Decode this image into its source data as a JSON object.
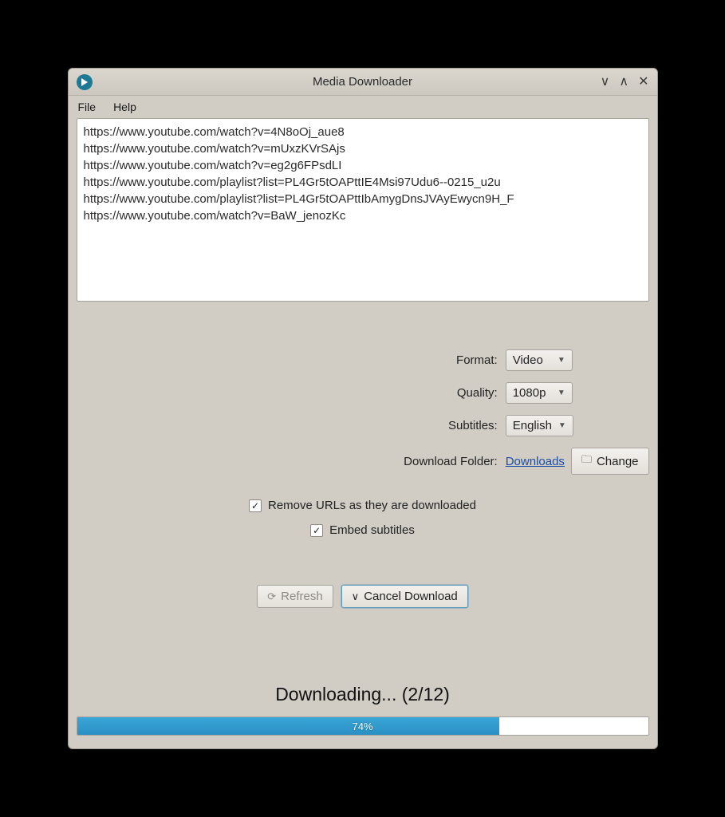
{
  "window": {
    "title": "Media Downloader"
  },
  "menubar": {
    "file": "File",
    "help": "Help"
  },
  "urls_text": "https://www.youtube.com/watch?v=4N8oOj_aue8\nhttps://www.youtube.com/watch?v=mUxzKVrSAjs\nhttps://www.youtube.com/watch?v=eg2g6FPsdLI\nhttps://www.youtube.com/playlist?list=PL4Gr5tOAPttIE4Msi97Udu6--0215_u2u\nhttps://www.youtube.com/playlist?list=PL4Gr5tOAPttIbAmygDnsJVAyEwycn9H_F\nhttps://www.youtube.com/watch?v=BaW_jenozKc",
  "form": {
    "format": {
      "label": "Format:",
      "value": "Video"
    },
    "quality": {
      "label": "Quality:",
      "value": "1080p"
    },
    "subtitles": {
      "label": "Subtitles:",
      "value": "English"
    },
    "folder": {
      "label": "Download Folder:",
      "link": "Downloads",
      "change": "Change"
    }
  },
  "checks": {
    "remove": {
      "label": "Remove URLs as they are downloaded",
      "checked": true
    },
    "embed": {
      "label": "Embed subtitles",
      "checked": true
    }
  },
  "actions": {
    "refresh": "Refresh",
    "cancel": "Cancel Download"
  },
  "status": {
    "text": "Downloading... (2/12)",
    "progress_pct": 74,
    "progress_label": "74%"
  }
}
